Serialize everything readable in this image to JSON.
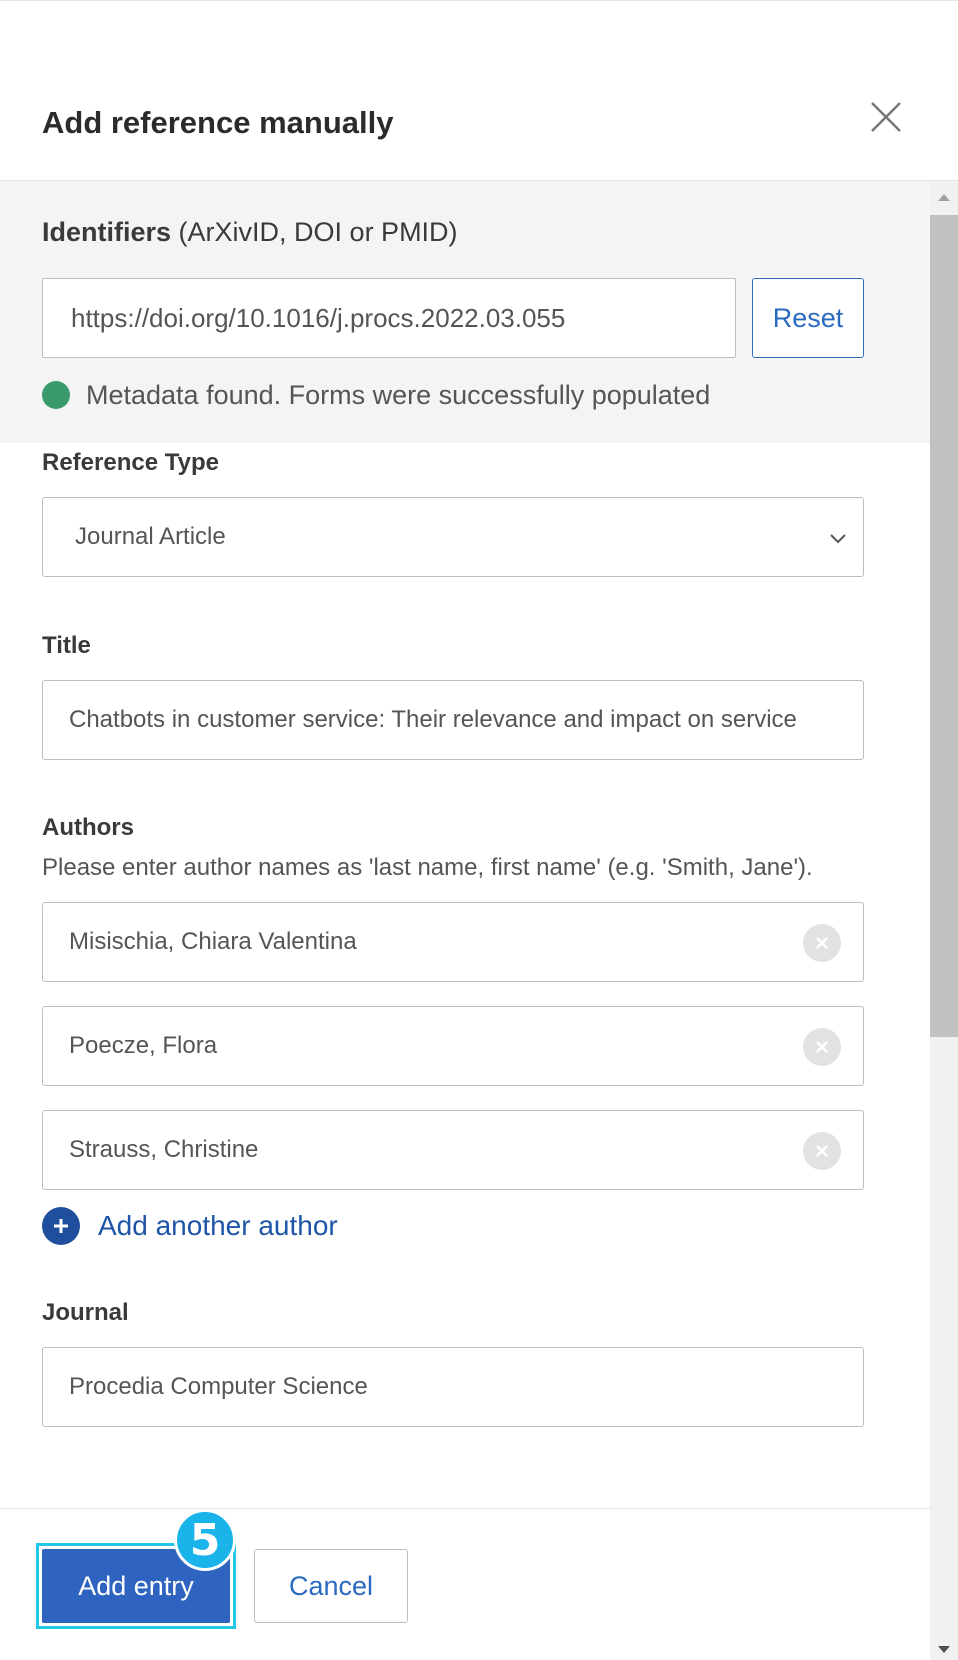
{
  "dialog": {
    "title": "Add reference manually",
    "close_icon": "close-icon"
  },
  "identifiers": {
    "label_bold": "Identifiers",
    "label_hint": "(ArXivID, DOI or PMID)",
    "value": "https://doi.org/10.1016/j.procs.2022.03.055",
    "reset_label": "Reset",
    "status_text": "Metadata found. Forms were successfully populated",
    "status_color": "#3b9a6c"
  },
  "reference_type": {
    "label": "Reference Type",
    "selected": "Journal Article"
  },
  "title_field": {
    "label": "Title",
    "value": "Chatbots in customer service: Their relevance and impact on service"
  },
  "authors": {
    "label": "Authors",
    "help": "Please enter author names as 'last name, first name' (e.g. 'Smith, Jane').",
    "items": [
      {
        "name": "Misischia, Chiara Valentina"
      },
      {
        "name": "Poecze, Flora"
      },
      {
        "name": "Strauss, Christine"
      }
    ],
    "add_label": "Add another author"
  },
  "journal": {
    "label": "Journal",
    "value": "Procedia Computer Science"
  },
  "footer": {
    "add_entry_label": "Add entry",
    "cancel_label": "Cancel",
    "step_badge": "5",
    "accent_color": "#2e64c0",
    "highlight_color": "#21c7e8"
  }
}
